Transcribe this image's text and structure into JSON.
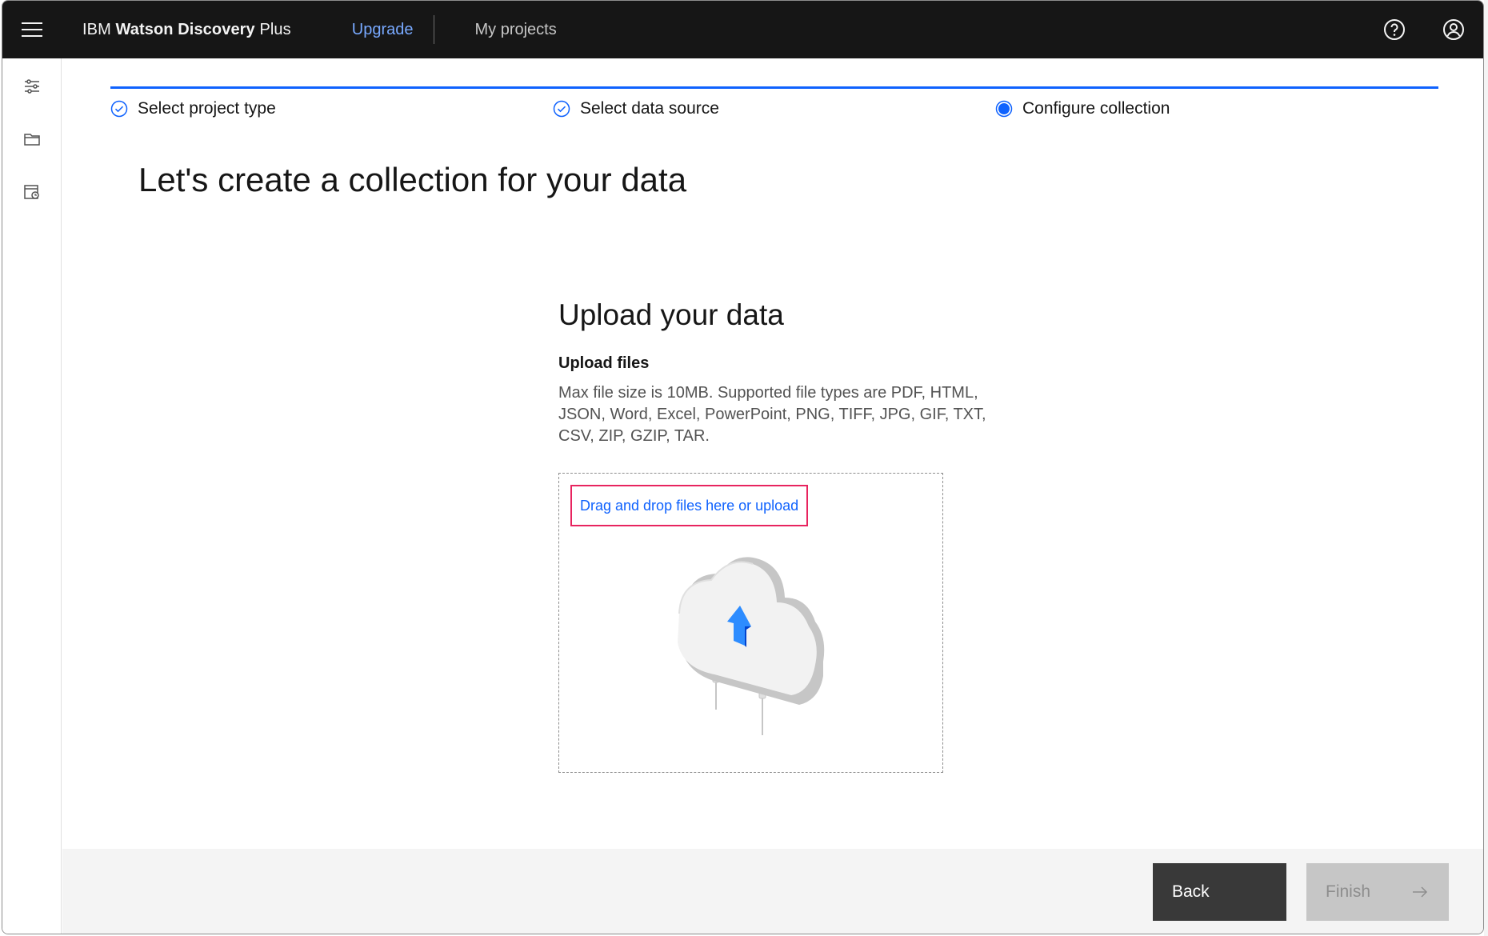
{
  "header": {
    "brand_prefix": "IBM",
    "brand_bold": "Watson Discovery",
    "brand_suffix": "Plus",
    "upgrade_label": "Upgrade",
    "projects_label": "My projects",
    "help_icon": "help-icon",
    "user_icon": "user-avatar-icon"
  },
  "rail": {
    "icons": [
      "settings-adjust-icon",
      "folder-icon",
      "data-collection-icon"
    ]
  },
  "progress": {
    "steps": [
      {
        "label": "Select project type",
        "state": "complete"
      },
      {
        "label": "Select data source",
        "state": "complete"
      },
      {
        "label": "Configure collection",
        "state": "current"
      }
    ]
  },
  "main": {
    "title": "Let's create a collection for your data",
    "upload_heading": "Upload your data",
    "upload_subheading": "Upload files",
    "upload_description": "Max file size is 10MB. Supported file types are PDF, HTML, JSON, Word, Excel, PowerPoint, PNG, TIFF, JPG, GIF, TXT, CSV, ZIP, GZIP, TAR.",
    "drop_link": "Drag and drop files here or upload",
    "illustration": "cloud-upload-illustration"
  },
  "footer": {
    "back_label": "Back",
    "finish_label": "Finish",
    "finish_icon": "arrow-right-icon"
  },
  "colors": {
    "header_bg": "#161616",
    "accent": "#0f62fe",
    "upgrade_link": "#78a9ff",
    "highlight_border": "#e8245f",
    "back_btn": "#393939",
    "finish_btn_disabled": "#c6c6c6"
  }
}
